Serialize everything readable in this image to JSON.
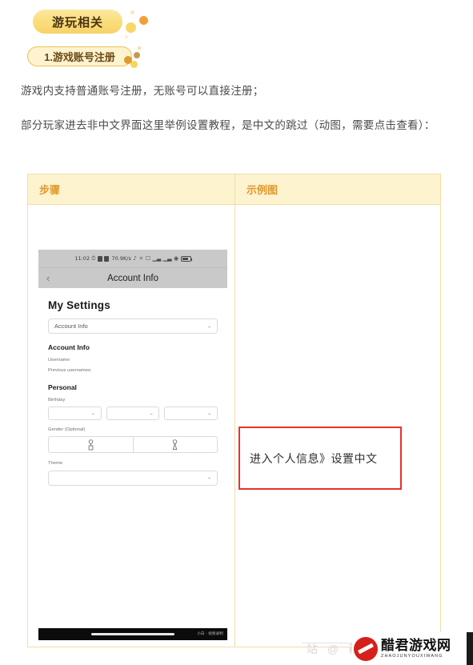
{
  "header": {
    "badge_primary": "游玩相关",
    "badge_secondary": "1.游戏账号注册"
  },
  "paragraphs": {
    "p1": "游戏内支持普通账号注册，无账号可以直接注册；",
    "p2": "部分玩家进去非中文界面这里举例设置教程，是中文的跳过（动图，需要点击查看）："
  },
  "table": {
    "headers": [
      "步骤",
      "示例图"
    ],
    "header_color": "#e0982a",
    "header_bg": "#fdf3cf",
    "border_color": "#f0dfa6"
  },
  "phone": {
    "status_bar": {
      "time": "11:02",
      "net_speed": "70.9K/s",
      "icons": [
        "alarm-icon",
        "sim-block-icon",
        "sim-block-icon-2",
        "mute-icon",
        "dnd-icon",
        "vpn-icon",
        "signal-icon",
        "signal-icon-2",
        "wifi-icon",
        "battery-icon"
      ]
    },
    "nav_bar": {
      "back_icon": "chevron-left-icon",
      "title": "Account Info"
    },
    "form": {
      "my_settings_heading": "My Settings",
      "settings_select_value": "Account Info",
      "account_info_heading": "Account Info",
      "username_label": "Username:",
      "previous_usernames_label": "Previous usernames:",
      "personal_heading": "Personal",
      "birthday_label": "Birthday",
      "birthday_selects": [
        "",
        "",
        ""
      ],
      "gender_label": "Gender (Optional)",
      "gender_options": [
        "male-gender-icon",
        "female-gender-icon"
      ],
      "theme_label": "Theme",
      "theme_select_value": ""
    },
    "home_bar_label": "小白 · 视频录制"
  },
  "annotation": {
    "text": "进入个人信息》设置中文",
    "border_color": "#e8322a"
  },
  "watermark": {
    "ghost_text": "站 @ 菘",
    "brand_cn": "醋君游戏网",
    "brand_en": "ZHAOJUNYOUXIWANG"
  }
}
